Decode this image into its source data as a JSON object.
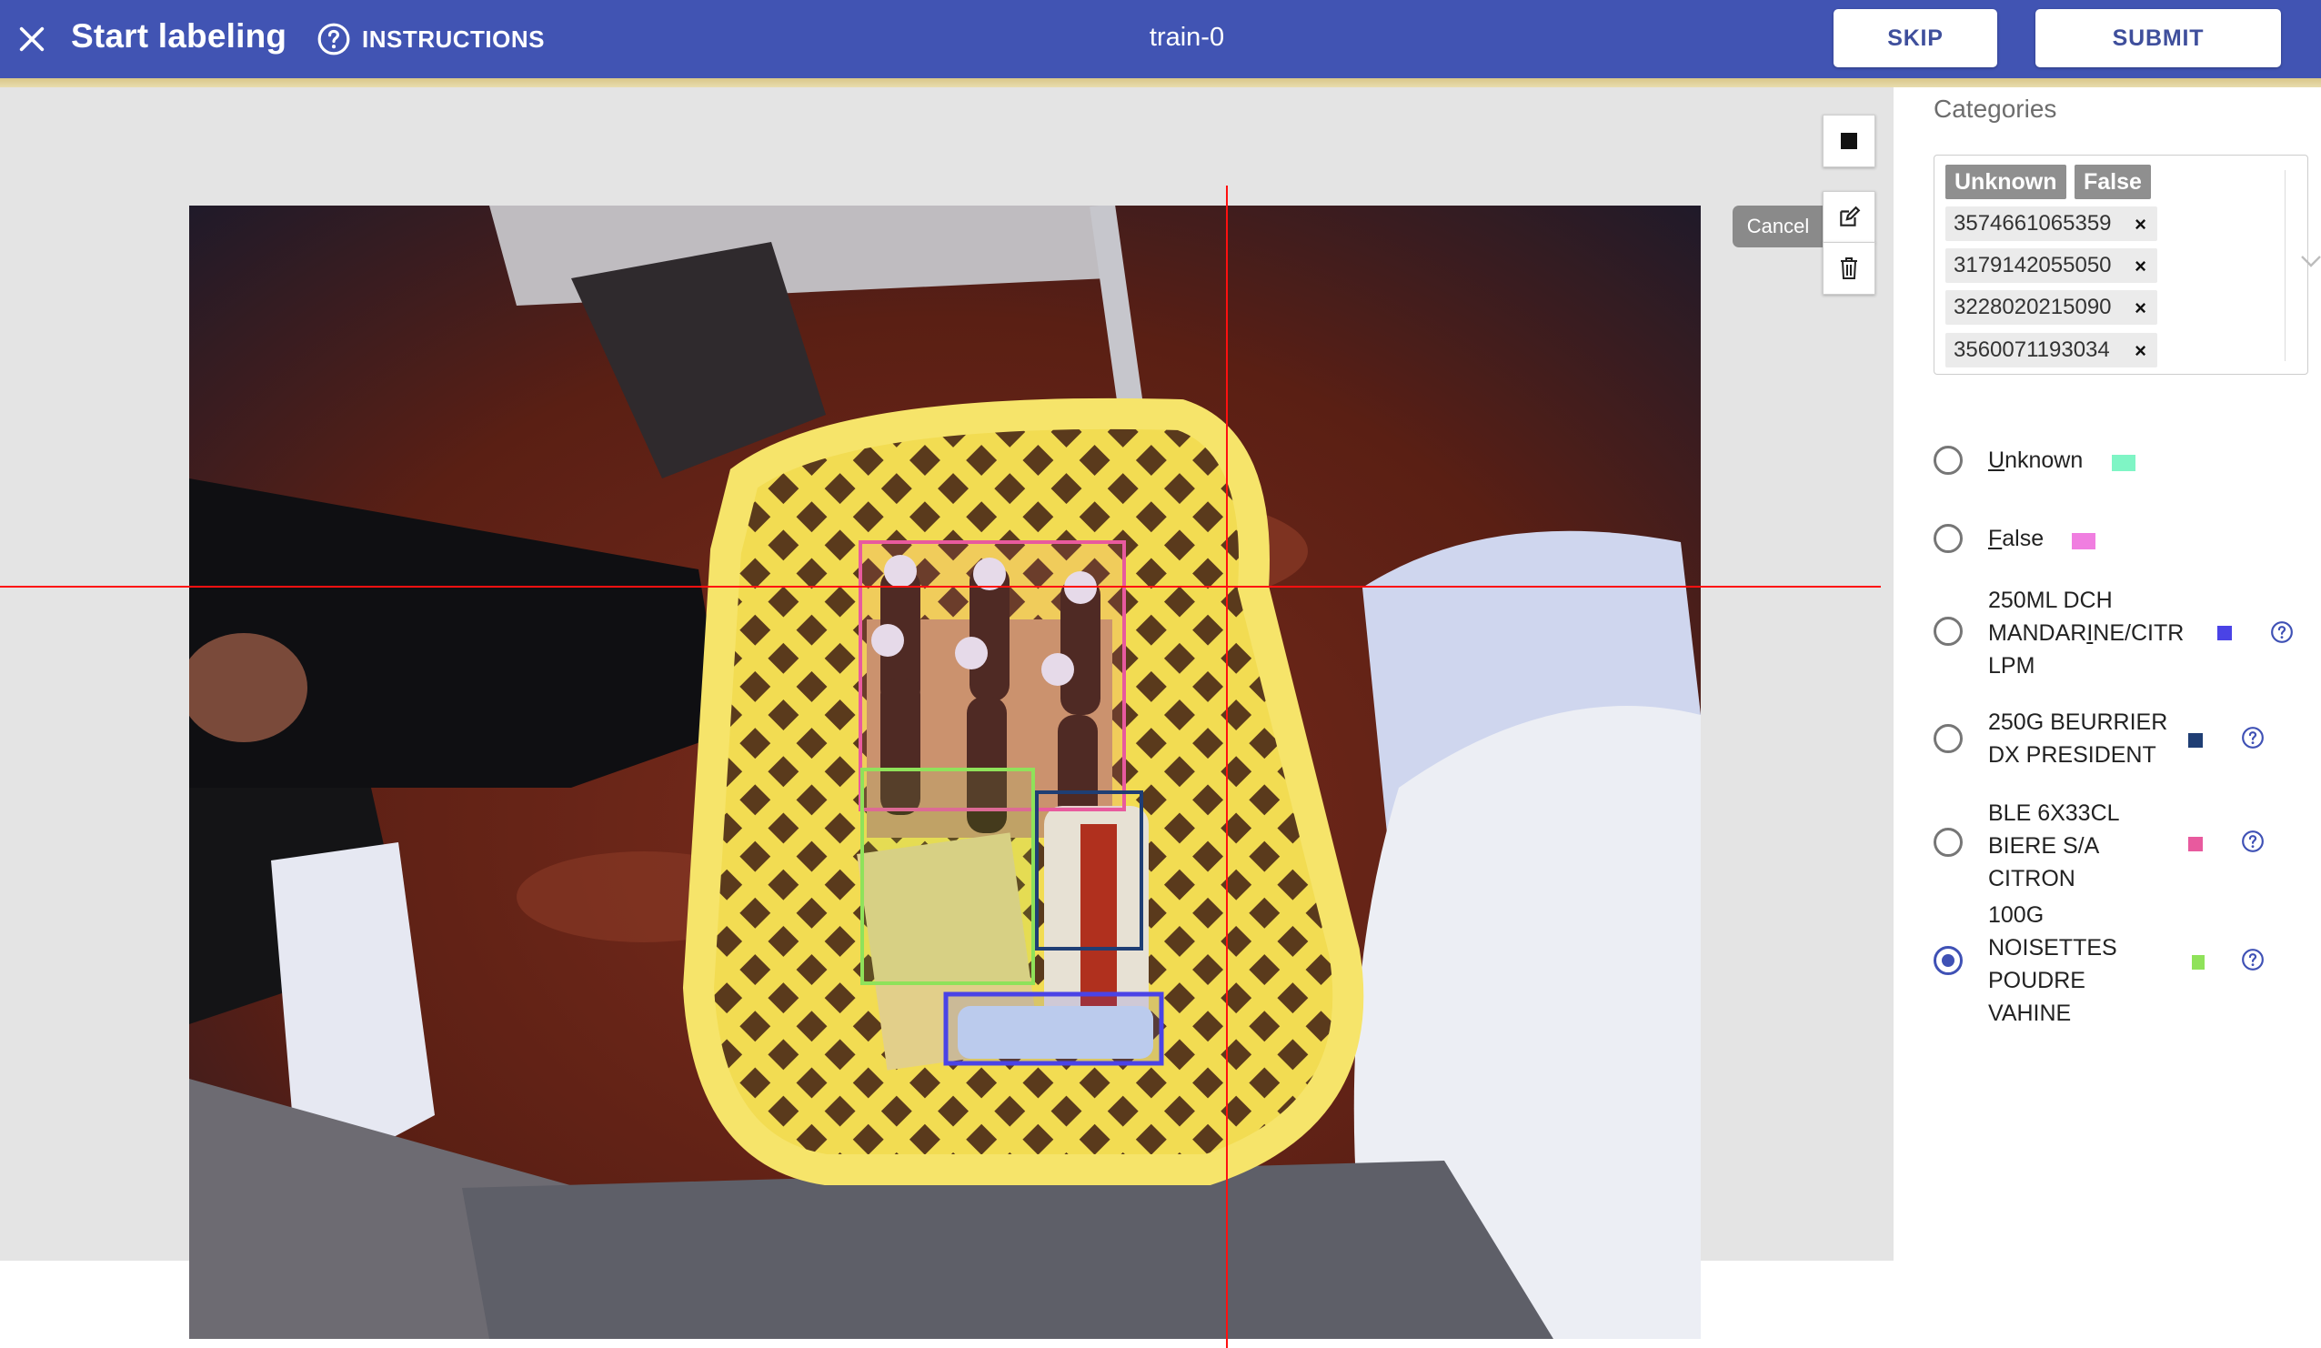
{
  "header": {
    "close_icon": "close-icon",
    "title": "Start labeling",
    "instructions_icon": "help-circle-icon",
    "instructions_label": "INSTRUCTIONS",
    "task_name": "train-0",
    "skip_label": "SKIP",
    "submit_label": "SUBMIT",
    "bar_color": "#4154b3"
  },
  "canvas": {
    "cancel_label": "Cancel",
    "tools": [
      "stop-icon",
      "edit-icon",
      "trash-icon"
    ],
    "crosshair_color": "#ff1010"
  },
  "panel": {
    "categories_label": "Categories",
    "selected_tags": [
      "Unknown",
      "False"
    ],
    "selected_chips": [
      "3574661065359",
      "3179142055050",
      "3228020215090",
      "3560071193034"
    ],
    "chip_remove": "×",
    "options": [
      {
        "pre": "",
        "u": "U",
        "post": "nknown",
        "color": "#7ff5c5",
        "help": false,
        "selected": false
      },
      {
        "pre": "",
        "u": "F",
        "post": "alse",
        "color": "#f07ee0",
        "help": false,
        "selected": false
      },
      {
        "lines": [
          "250ML DCH",
          "MANDARINE/CITR",
          "LPM"
        ],
        "color": "#4a43e6",
        "help": true,
        "selected": false
      },
      {
        "lines": [
          "250G BEURRIER",
          "DX PRESIDENT"
        ],
        "color": "#1f3e74",
        "help": true,
        "selected": false
      },
      {
        "lines": [
          "BLE 6X33CL",
          "BIERE S/A",
          "CITRON"
        ],
        "color": "#e85a9e",
        "help": true,
        "selected": false
      },
      {
        "lines": [
          "100G",
          "NOISETTES",
          "POUDRE",
          "VAHINE"
        ],
        "color": "#8fe25a",
        "help": true,
        "selected": true
      }
    ],
    "option3_line2_pre": "MANDAR",
    "option3_line2_u": "I",
    "option3_line2_post": "NE/CITR"
  },
  "annotations": [
    {
      "label": "BLE 6X33CL BIERE S/A CITRON",
      "color": "#e85a9e"
    },
    {
      "label": "100G NOISETTES POUDRE VAHINE",
      "color": "#8fe25a"
    },
    {
      "label": "250G BEURRIER DX PRESIDENT",
      "color": "#1f3e74"
    },
    {
      "label": "250ML DCH MANDARINE/CITR LPM",
      "color": "#4a43e6"
    }
  ]
}
